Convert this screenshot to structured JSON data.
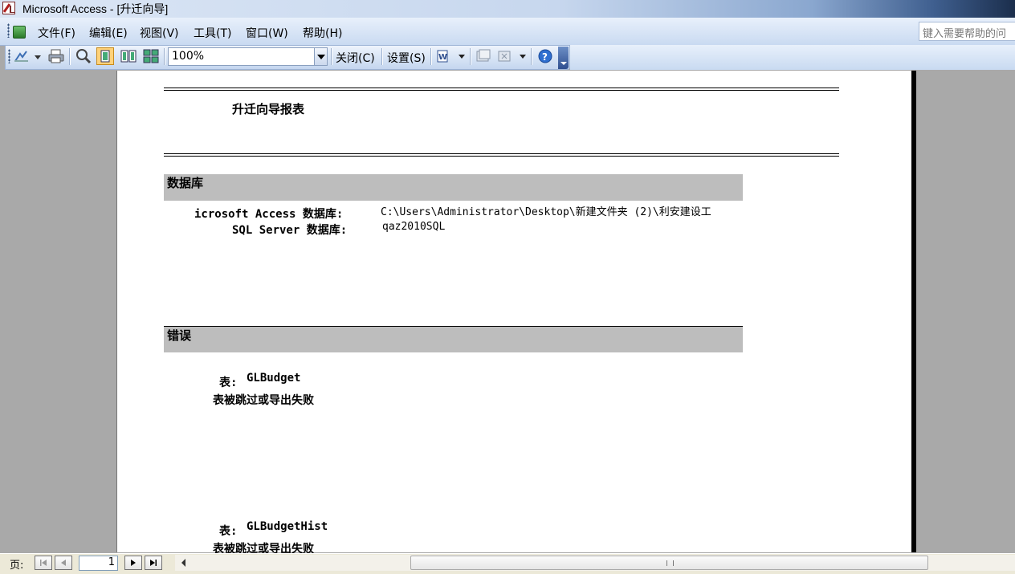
{
  "window": {
    "title": "Microsoft Access - [升迁向导]",
    "help_placeholder": "键入需要帮助的问"
  },
  "menu": [
    "文件(F)",
    "编辑(E)",
    "视图(V)",
    "工具(T)",
    "窗口(W)",
    "帮助(H)"
  ],
  "toolbar": {
    "zoom": "100%",
    "close_label": "关闭(C)",
    "setup_label": "设置(S)"
  },
  "report": {
    "title": "升迁向导报表",
    "database_section": "数据库",
    "access_label": "icrosoft  Access  数据库:",
    "access_value": "C:\\Users\\Administrator\\Desktop\\新建文件夹 (2)\\利安建设工",
    "sql_label": "SQL  Server  数据库:",
    "sql_value": "qaz2010SQL",
    "error_section": "错误",
    "errors": [
      {
        "table_label": "表:",
        "table_name": "GLBudget",
        "message": "表被跳过或导出失败"
      },
      {
        "table_label": "表:",
        "table_name": "GLBudgetHist",
        "message": "表被跳过或导出失败"
      }
    ]
  },
  "statusbar": {
    "page_label": "页:",
    "page_value": "1"
  }
}
